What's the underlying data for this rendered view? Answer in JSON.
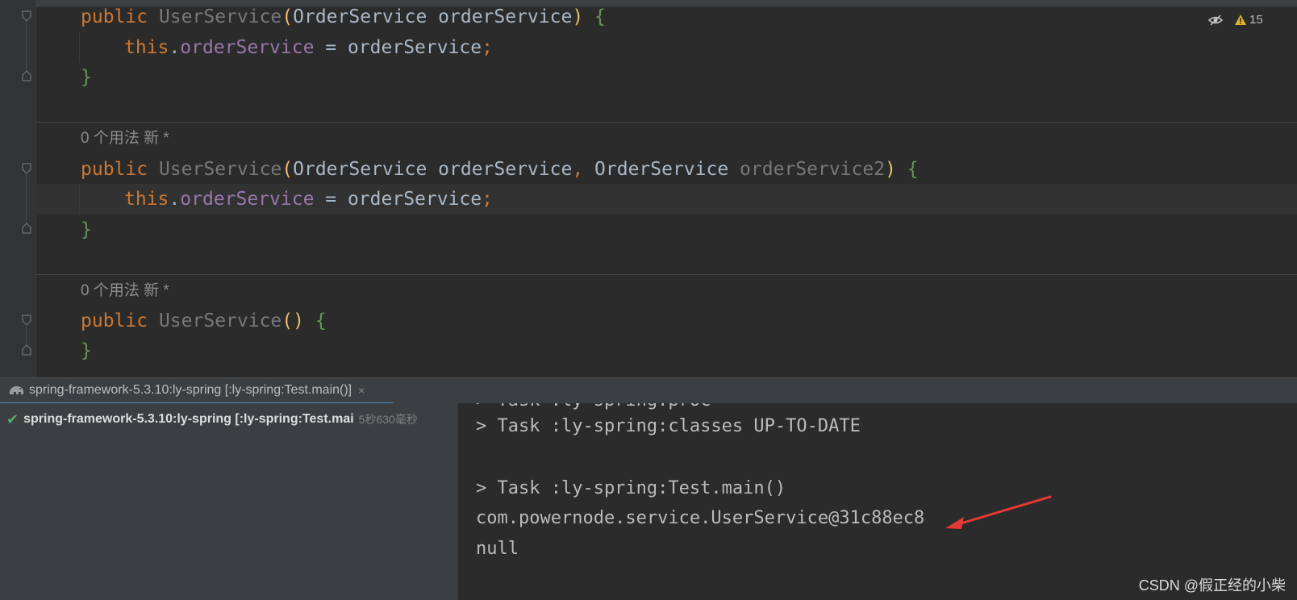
{
  "editor": {
    "warning_count": "15",
    "block1": {
      "line1": {
        "kw": "public",
        "name": "UserService",
        "open_paren": "(",
        "type": "OrderService",
        "param": " orderService",
        "close_paren": ")",
        "brace": "{"
      },
      "line2": {
        "this": "this",
        "dot": ".",
        "field": "orderService",
        "rest": " = orderService",
        "semi": ";"
      },
      "line3": {
        "brace": "}"
      }
    },
    "block2": {
      "hint": "0 个用法   新 *",
      "line1": {
        "kw": "public",
        "name": "UserService",
        "open_paren": "(",
        "type1": "OrderService",
        "param1": " orderService",
        "comma": ",",
        "type2": " OrderService",
        "param2": " orderService2",
        "close_paren": ")",
        "brace": "{"
      },
      "line2": {
        "this": "this",
        "dot": ".",
        "field": "orderService",
        "rest": " = orderService",
        "semi": ";"
      },
      "line3": {
        "brace": "}"
      }
    },
    "block3": {
      "hint": "0 个用法   新 *",
      "line1": {
        "kw": "public",
        "name": "UserService",
        "parens": "()",
        "brace": "{"
      },
      "line2": {
        "brace": "}"
      }
    }
  },
  "run_panel": {
    "tab_label": "spring-framework-5.3.10:ly-spring [:ly-spring:Test.main()]",
    "tab_close": "×",
    "tree_item": {
      "label": "spring-framework-5.3.10:ly-spring [:ly-spring:Test.mai",
      "duration": "5秒630毫秒",
      "status": "success"
    }
  },
  "console": {
    "lines": [
      "> Task :ly-spring:classes UP-TO-DATE",
      "",
      "> Task :ly-spring:Test.main()",
      "com.powernode.service.UserService@31c88ec8",
      "null"
    ],
    "annotation_color": "#e53935"
  },
  "watermark": "CSDN @假正经的小柴"
}
